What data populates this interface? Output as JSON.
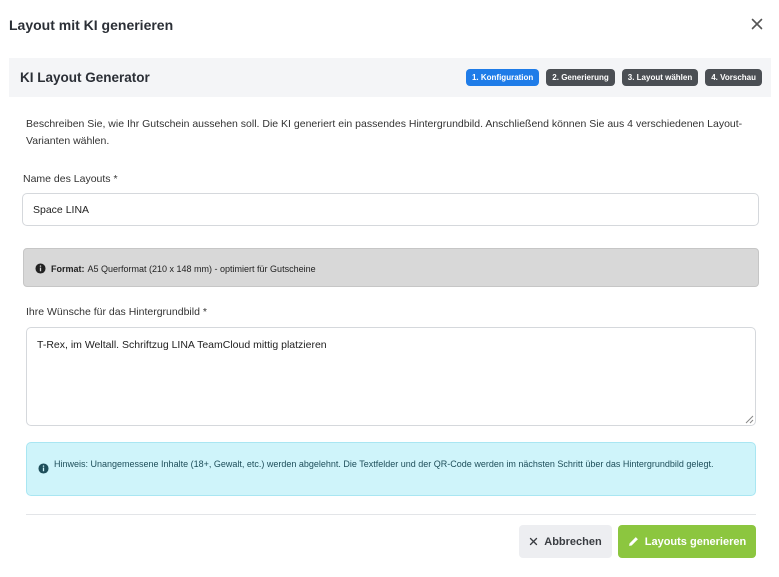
{
  "modal": {
    "title": "Layout mit KI generieren"
  },
  "generator": {
    "title": "KI Layout Generator",
    "steps": [
      {
        "label": "1. Konfiguration",
        "active": true
      },
      {
        "label": "2. Generierung",
        "active": false
      },
      {
        "label": "3. Layout wählen",
        "active": false
      },
      {
        "label": "4. Vorschau",
        "active": false
      }
    ]
  },
  "intro_text": "Beschreiben Sie, wie Ihr Gutschein aussehen soll. Die KI generiert ein passendes Hintergrundbild. Anschließend können Sie aus 4 verschiedenen Layout-Varianten wählen.",
  "name_field": {
    "label": "Name des Layouts *",
    "value": "Space LINA"
  },
  "format_info": {
    "label": "Format:",
    "text": "A5 Querformat (210 x 148 mm) - optimiert für Gutscheine"
  },
  "wishes_field": {
    "label": "Ihre Wünsche für das Hintergrundbild *",
    "value": "T-Rex, im Weltall. Schriftzug LINA TeamCloud mittig platzieren"
  },
  "hint": {
    "text": "Hinweis: Unangemessene Inhalte (18+, Gewalt, etc.) werden abgelehnt. Die Textfelder und der QR-Code werden im nächsten Schritt über das Hintergrundbild gelegt."
  },
  "buttons": {
    "cancel_label": "Abbrechen",
    "generate_label": "Layouts generieren"
  },
  "colors": {
    "active_step": "#1f7ce8",
    "inactive_step": "#4b4f54",
    "primary_button": "#8cc63f",
    "hint_background": "#cff4fa",
    "format_background": "#d8d8d8"
  },
  "icons": {
    "close": "close-icon",
    "format_info": "info-circle-icon",
    "hint_info": "info-circle-icon",
    "cancel": "x-icon",
    "generate": "pencil-icon"
  }
}
